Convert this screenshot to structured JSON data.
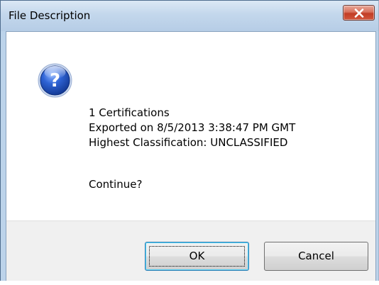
{
  "window": {
    "title": "File Description"
  },
  "icons": {
    "dialog_icon": "question-icon",
    "close": "close-icon"
  },
  "message": {
    "lines": [
      "1 Certifications",
      "Exported on 8/5/2013 3:38:47 PM GMT",
      "Highest Classification: UNCLASSIFIED"
    ],
    "prompt": "Continue?"
  },
  "buttons": {
    "ok_label": "OK",
    "cancel_label": "Cancel"
  },
  "colors": {
    "titlebar": "#c3d7ec",
    "close_button": "#c13d25",
    "icon_blue": "#1f4fb0",
    "button_bar": "#f0f0f0"
  }
}
